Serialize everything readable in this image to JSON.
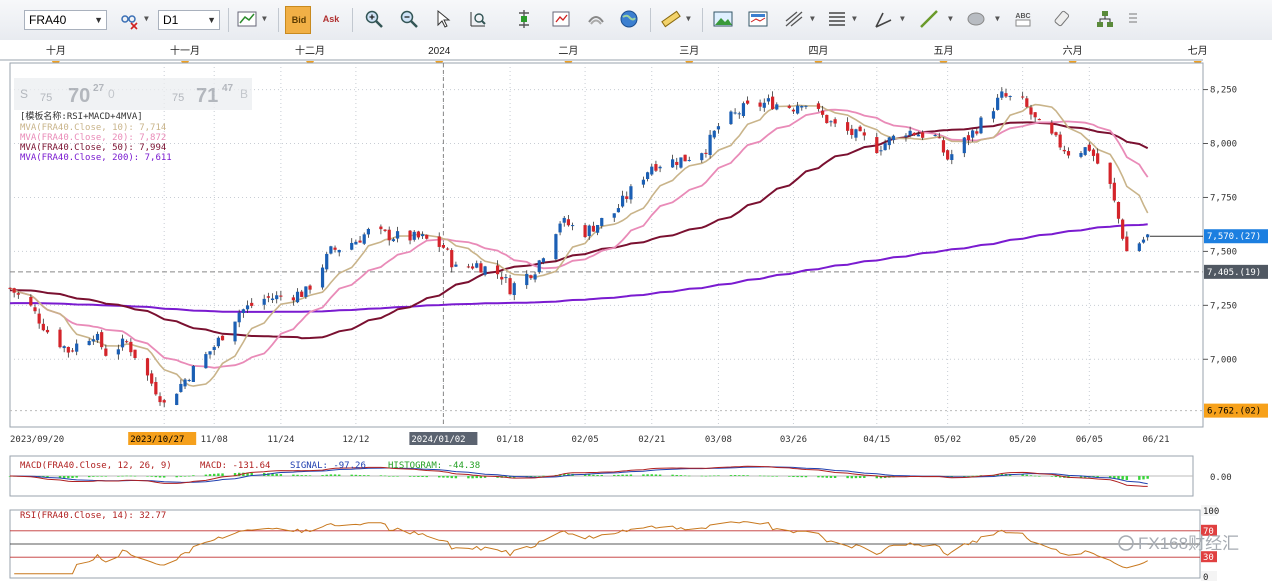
{
  "toolbar": {
    "symbol": "FRA40",
    "timeframe": "D1",
    "icons": [
      "chart-type-icon",
      "bid-icon",
      "ask-icon",
      "zoom-in-icon",
      "zoom-out-icon",
      "cursor-icon",
      "zoom-fit-icon",
      "crosshair-icon",
      "auto-scroll-icon",
      "chart-shift-icon",
      "globe-icon",
      "ruler-icon",
      "image-icon",
      "template-icon",
      "fibonacci-icon",
      "lines-icon",
      "pen-icon",
      "trendline-icon",
      "ellipse-icon",
      "text-icon",
      "eraser-icon",
      "network-icon",
      "scroll-icon"
    ],
    "button_labels": {
      "bid": "Bid",
      "ask": "Ask",
      "text": "ABC"
    }
  },
  "quote_panel": {
    "bid_prefix": "S",
    "bid_small": "75",
    "bid_big": "70",
    "bid_sup": "27",
    "bid_tail": "0",
    "ask_small": "75",
    "ask_big": "71",
    "ask_sup": "47",
    "ask_suffix": "B"
  },
  "legend": {
    "template": "[模板名称:RSI+MACD+4MVA]",
    "mva10": "MVA(FRA40.Close, 10): 7,714",
    "mva20": "MVA(FRA40.Close, 20): 7,872",
    "mva50": "MVA(FRA40.Close, 50): 7,994",
    "mva200": "MVA(FRA40.Close, 200): 7,611"
  },
  "colors": {
    "up": "#1b5fb4",
    "down": "#d4242a",
    "mva10": "#c9b48a",
    "mva20": "#e98bb8",
    "mva50": "#7a1030",
    "mva200": "#7a1bd0",
    "grid": "#c8cdd4",
    "macd_hist": "#39d439",
    "rsi": "#c8781e"
  },
  "month_labels": [
    "十月",
    "十一月",
    "十二月",
    "2024",
    "二月",
    "三月",
    "四月",
    "五月",
    "六月",
    "七月"
  ],
  "price_scale": {
    "ticks": [
      "8,250",
      "8,000",
      "7,750",
      "7,500",
      "7,250",
      "7,000"
    ],
    "current_price_label": "7,570.(27)",
    "reference_price_label": "7,405.(19)",
    "low_price_label": "6,762.(02)"
  },
  "date_axis": {
    "labels": [
      "2023/09/20",
      "11/08",
      "11/24",
      "12/12",
      "01/18",
      "02/05",
      "02/21",
      "03/08",
      "03/26",
      "04/15",
      "05/02",
      "05/20",
      "06/05",
      "06/21"
    ],
    "highlight_left": "2023/10/27",
    "highlight_mid": "2024/01/02",
    "partial_prefix": "1"
  },
  "macd_panel": {
    "label": "MACD(FRA40.Close, 12, 26, 9)",
    "macd_value": "MACD: -131.64",
    "signal_value": "SIGNAL: -97.26",
    "histogram_value": "HISTOGRAM: -44.38",
    "zero_tick": "0.00"
  },
  "rsi_panel": {
    "label": "RSI(FRA40.Close, 14): 32.77",
    "ticks": [
      "100",
      "70",
      "30",
      "0"
    ]
  },
  "watermark": "FX168财经汇",
  "chart_data": {
    "type": "candlestick",
    "title": "FRA40 D1",
    "ylim": [
      6700,
      8350
    ],
    "x_start": "2023-09-20",
    "x_end": "2024-06-21",
    "close_approx": [
      [
        "2023-09-20",
        7330
      ],
      [
        "2023-09-25",
        7240
      ],
      [
        "2023-09-29",
        7130
      ],
      [
        "2023-10-04",
        7040
      ],
      [
        "2023-10-10",
        7120
      ],
      [
        "2023-10-13",
        7030
      ],
      [
        "2023-10-18",
        7080
      ],
      [
        "2023-10-20",
        7020
      ],
      [
        "2023-10-23",
        6920
      ],
      [
        "2023-10-26",
        6830
      ],
      [
        "2023-10-27",
        6790
      ],
      [
        "2023-11-02",
        6930
      ],
      [
        "2023-11-08",
        7060
      ],
      [
        "2023-11-14",
        7220
      ],
      [
        "2023-11-20",
        7280
      ],
      [
        "2023-11-24",
        7290
      ],
      [
        "2023-11-30",
        7310
      ],
      [
        "2023-12-06",
        7500
      ],
      [
        "2023-12-12",
        7550
      ],
      [
        "2023-12-15",
        7590
      ],
      [
        "2023-12-21",
        7570
      ],
      [
        "2023-12-28",
        7560
      ],
      [
        "2024-01-02",
        7520
      ],
      [
        "2024-01-05",
        7420
      ],
      [
        "2024-01-10",
        7440
      ],
      [
        "2024-01-16",
        7390
      ],
      [
        "2024-01-18",
        7330
      ],
      [
        "2024-01-24",
        7420
      ],
      [
        "2024-01-30",
        7640
      ],
      [
        "2024-02-05",
        7590
      ],
      [
        "2024-02-12",
        7680
      ],
      [
        "2024-02-16",
        7780
      ],
      [
        "2024-02-21",
        7900
      ],
      [
        "2024-02-29",
        7930
      ],
      [
        "2024-03-05",
        7980
      ],
      [
        "2024-03-08",
        8080
      ],
      [
        "2024-03-14",
        8160
      ],
      [
        "2024-03-20",
        8190
      ],
      [
        "2024-03-26",
        8170
      ],
      [
        "2024-03-28",
        8200
      ],
      [
        "2024-04-05",
        8080
      ],
      [
        "2024-04-12",
        8020
      ],
      [
        "2024-04-15",
        7980
      ],
      [
        "2024-04-22",
        8060
      ],
      [
        "2024-04-29",
        8030
      ],
      [
        "2024-05-02",
        7930
      ],
      [
        "2024-05-08",
        8050
      ],
      [
        "2024-05-15",
        8220
      ],
      [
        "2024-05-20",
        8190
      ],
      [
        "2024-05-24",
        8080
      ],
      [
        "2024-05-31",
        7960
      ],
      [
        "2024-06-05",
        7980
      ],
      [
        "2024-06-10",
        7800
      ],
      [
        "2024-06-14",
        7500
      ],
      [
        "2024-06-19",
        7570
      ]
    ],
    "mva_latest": {
      "MVA10": 7714,
      "MVA20": 7872,
      "MVA50": 7994,
      "MVA200": 7611
    },
    "macd_latest": {
      "MACD": -131.64,
      "SIGNAL": -97.26,
      "HISTOGRAM": -44.38
    },
    "rsi_latest": 32.77,
    "rsi_levels": [
      70,
      30
    ]
  }
}
